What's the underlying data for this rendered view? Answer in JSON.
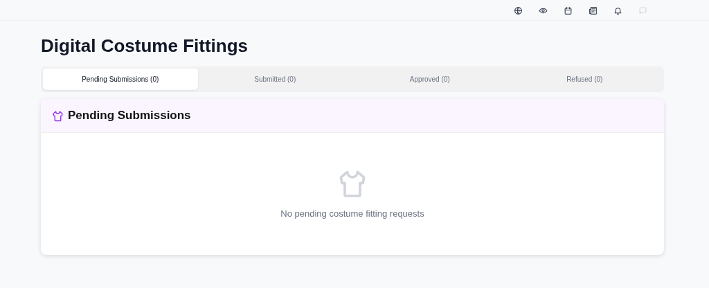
{
  "toolbar": [
    {
      "kind": "globe",
      "disabled": false
    },
    {
      "kind": "eye",
      "disabled": false
    },
    {
      "kind": "calendar",
      "disabled": false
    },
    {
      "kind": "newspaper",
      "disabled": false
    },
    {
      "kind": "bell",
      "disabled": false
    },
    {
      "kind": "chat",
      "disabled": true
    }
  ],
  "page": {
    "title": "Digital Costume Fittings"
  },
  "tabs": [
    {
      "label": "Pending Submissions (0)",
      "selected": true
    },
    {
      "label": "Submitted (0)",
      "selected": false
    },
    {
      "label": "Approved (0)",
      "selected": false
    },
    {
      "label": "Refused (0)",
      "selected": false
    }
  ],
  "panel": {
    "title": "Pending Submissions",
    "empty_message": "No pending costume fitting requests"
  }
}
